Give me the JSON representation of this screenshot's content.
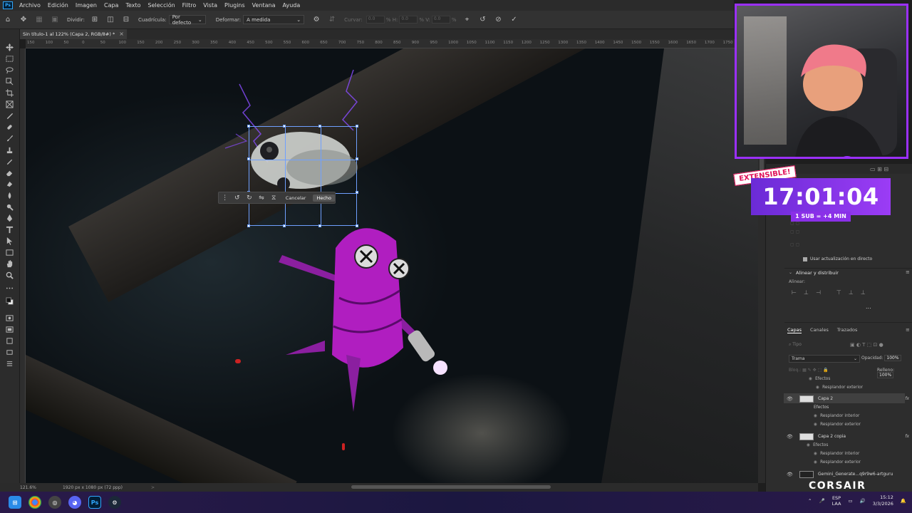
{
  "menu": [
    "Archivo",
    "Edición",
    "Imagen",
    "Capa",
    "Texto",
    "Selección",
    "Filtro",
    "Vista",
    "Plugins",
    "Ventana",
    "Ayuda"
  ],
  "options": {
    "dividir_label": "Dividir:",
    "cuadricula_label": "Cuadrícula:",
    "cuadricula_value": "Por defecto",
    "deformar_label": "Deformar:",
    "deformar_value": "A medida",
    "curvar_label": "Curvar:",
    "curvar_value": "0.0",
    "h_value": "0.0",
    "v_value": "0.0"
  },
  "tab": {
    "title": "Sin título-1 al 122% (Capa 2, RGB/8#) *",
    "close": "×"
  },
  "ruler_ticks": [
    "150",
    "100",
    "50",
    "0",
    "50",
    "100",
    "150",
    "200",
    "250",
    "300",
    "350",
    "400",
    "450",
    "500",
    "550",
    "600",
    "650",
    "700",
    "750",
    "800",
    "850",
    "900",
    "950",
    "1000",
    "1050",
    "1100",
    "1150",
    "1200",
    "1250",
    "1300",
    "1350",
    "1400",
    "1450",
    "1500",
    "1550",
    "1600",
    "1650",
    "1700",
    "1750",
    "1800"
  ],
  "warp_bar": {
    "cancel": "Cancelar",
    "done": "Hecho"
  },
  "status": {
    "zoom": "121.6%",
    "dims": "1920 px x 1080 px (72 ppp)",
    "arrow": ">"
  },
  "properties": {
    "live_update": "Usar actualización en directo",
    "align_title": "Alinear y distribuir",
    "align_label": "Alinear:",
    "more": "..."
  },
  "layers": {
    "tabs": [
      "Capas",
      "Canales",
      "Trazados"
    ],
    "search_placeholder": "Tipo",
    "blend_mode": "Trama",
    "opacity_label": "Opacidad:",
    "opacity_value": "100%",
    "lock_label": "Bloq.:",
    "fill_label": "Relleno:",
    "fill_value": "100%",
    "items": [
      {
        "name": "Capa 2",
        "fx": "fx"
      },
      {
        "name": "Capa 2 copia",
        "fx": "fx"
      },
      {
        "name": "Gemini_Generate...q9r9w6-artguru",
        "fx": ""
      }
    ],
    "effects": {
      "efectos": "Efectos",
      "outer_glow": "Resplandor exterior",
      "inner_glow": "Resplandor interior"
    }
  },
  "overlay": {
    "extensible": "EXTENSIBLE!",
    "timer": "17:01:04",
    "sub_rule": "1 SUB = +4 MIN",
    "brand": "CORSAIR"
  },
  "taskbar": {
    "lang_top": "ESP",
    "lang_bottom": "LAA",
    "time": "15:12",
    "date": "3/3/2026",
    "ps_label": "Ps"
  },
  "colors": {
    "accent_purple": "#9b30ff",
    "selection_blue": "#6fa0ff",
    "ps_blue": "#31a8ff",
    "robot_magenta": "#b01ec0"
  },
  "icons": [
    "home-icon",
    "move-icon",
    "grid-icon",
    "settings-icon",
    "warp-icon",
    "undo-icon",
    "cancel-icon",
    "commit-icon",
    "eye-icon",
    "fx-icon",
    "windows-start-icon",
    "chrome-icon",
    "discord-icon",
    "steam-icon"
  ]
}
